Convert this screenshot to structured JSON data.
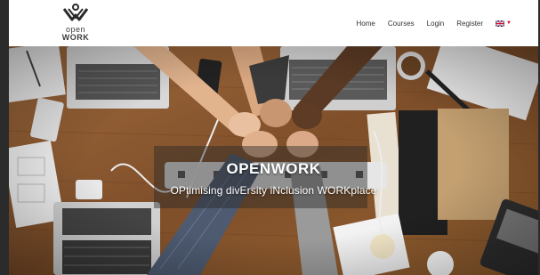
{
  "logo": {
    "top_word": "open",
    "bottom_word": "WORK"
  },
  "nav": {
    "items": [
      {
        "label": "Home"
      },
      {
        "label": "Courses"
      },
      {
        "label": "Login"
      },
      {
        "label": "Register"
      }
    ],
    "language": {
      "flag_icon": "uk-flag-icon",
      "caret_icon": "chevron-down-icon"
    }
  },
  "hero": {
    "title": "OPENWORK",
    "subtitle": "OPtimising divErsity iNclusion WORKplace"
  },
  "colors": {
    "text_dark": "#333333",
    "desk_wood": "#8a5a32",
    "flag_red": "#c8102e",
    "flag_blue": "#012169"
  }
}
